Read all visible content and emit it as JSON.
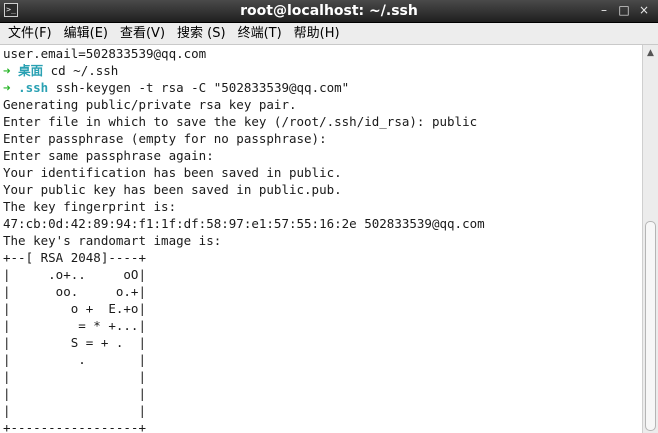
{
  "window": {
    "icon_label": ">_",
    "title": "root@localhost: ~/.ssh",
    "minimize_glyph": "–",
    "maximize_glyph": "□",
    "close_glyph": "×"
  },
  "menu": [
    "文件(F)",
    "编辑(E)",
    "查看(V)",
    "搜索 (S)",
    "终端(T)",
    "帮助(H)"
  ],
  "prompt_arrow": "➜",
  "prompts": [
    {
      "cwd": "桌面",
      "command": " cd ~/.ssh"
    },
    {
      "cwd": ".ssh",
      "command": " ssh-keygen -t rsa -C \"502833539@qq.com\""
    }
  ],
  "output_top": "user.email=502833539@qq.com",
  "output": [
    "Generating public/private rsa key pair.",
    "Enter file in which to save the key (/root/.ssh/id_rsa): public",
    "Enter passphrase (empty for no passphrase):",
    "Enter same passphrase again:",
    "Your identification has been saved in public.",
    "Your public key has been saved in public.pub.",
    "The key fingerprint is:",
    "47:cb:0d:42:89:94:f1:1f:df:58:97:e1:57:55:16:2e 502833539@qq.com",
    "The key's randomart image is:",
    "+--[ RSA 2048]----+",
    "|     .o+..     oO|",
    "|      oo.     o.+|",
    "|        o +  E.+o|",
    "|         = * +...|",
    "|        S = + .  |",
    "|         .       |",
    "|                 |",
    "|                 |",
    "|                 |",
    "+-----------------+"
  ],
  "colors": {
    "titlebar": "#2b2b2b",
    "prompt_arrow": "#27b527",
    "prompt_cwd": "#2aa1b3",
    "text": "#1a1a1a"
  },
  "icons": {
    "app": "terminal-icon",
    "scroll_up": "triangle-up-icon"
  }
}
